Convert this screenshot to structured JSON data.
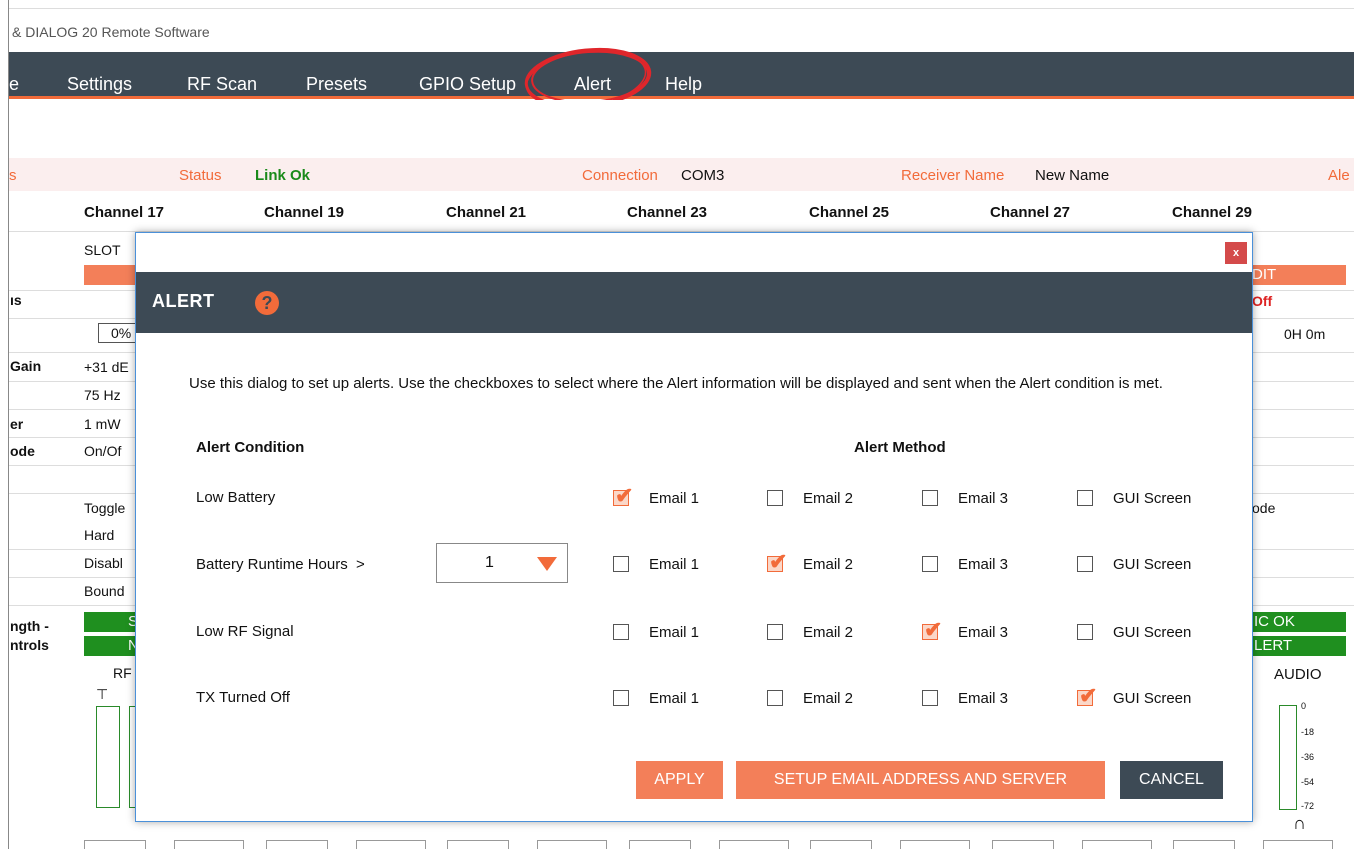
{
  "window": {
    "title": "& DIALOG 20 Remote Software"
  },
  "menu": {
    "items": [
      {
        "label": "e"
      },
      {
        "label": "Settings"
      },
      {
        "label": "RF Scan"
      },
      {
        "label": "Presets"
      },
      {
        "label": "GPIO Setup"
      },
      {
        "label": "Alert"
      },
      {
        "label": "Help"
      }
    ]
  },
  "status": {
    "left_cut": "s",
    "status_label": "Status",
    "status_value": "Link Ok",
    "connection_label": "Connection",
    "connection_value": "COM3",
    "receiver_label": "Receiver Name",
    "receiver_value": "New Name",
    "right_cut": "Ale"
  },
  "channels": [
    "Channel 17",
    "Channel 19",
    "Channel 21",
    "Channel 23",
    "Channel 25",
    "Channel 27",
    "Channel 29"
  ],
  "left_labels": [
    "ıs",
    "Gain",
    "er",
    "ode",
    "ngth -",
    "ntrols"
  ],
  "grid": {
    "col1": [
      "SLOT",
      "0%",
      "+31 dE",
      "75 Hz",
      "1 mW",
      "On/Of",
      "Toggle",
      "Hard",
      "Disabl",
      "Bound",
      "RF"
    ],
    "green_col1": [
      "S",
      "N"
    ],
    "right_col": [
      "DIT",
      "Off",
      "0H 0m",
      "ode",
      "IC OK",
      "LERT",
      "AUDIO"
    ],
    "meter_ticks": [
      "0",
      "-18",
      "-36",
      "-54",
      "-72"
    ]
  },
  "dialog": {
    "close_label": "x",
    "title": "ALERT",
    "help_label": "?",
    "description": "Use this dialog to set up alerts. Use the checkboxes to select where the Alert information will be displayed and sent when the Alert condition is met.",
    "col_condition": "Alert Condition",
    "col_method": "Alert Method",
    "methods": [
      "Email 1",
      "Email 2",
      "Email 3",
      "GUI Screen"
    ],
    "rows": [
      {
        "condition": "Low Battery",
        "checked": [
          true,
          false,
          false,
          false
        ]
      },
      {
        "condition": "Battery Runtime Hours  >",
        "checked": [
          false,
          true,
          false,
          false
        ]
      },
      {
        "condition": "Low RF Signal",
        "checked": [
          false,
          false,
          true,
          false
        ]
      },
      {
        "condition": "TX Turned Off",
        "checked": [
          false,
          false,
          false,
          true
        ]
      }
    ],
    "runtime_select": {
      "value": "1"
    },
    "buttons": {
      "apply": "APPLY",
      "setup": "SETUP EMAIL ADDRESS AND SERVER",
      "cancel": "CANCEL"
    }
  },
  "colors": {
    "accent": "#f26b3a",
    "header": "#3d4a55",
    "ok_green": "#1f8f1f",
    "highlight_circle": "#e0262b"
  }
}
